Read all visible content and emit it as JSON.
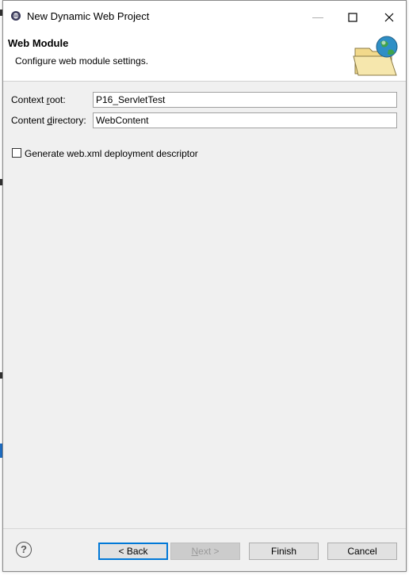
{
  "window": {
    "title": "New Dynamic Web Project",
    "minimize_glyph": "—",
    "maximize_glyph": "☐",
    "close_glyph": "✕"
  },
  "header": {
    "title": "Web Module",
    "description": "Configure web module settings.",
    "image_icon": "folder-globe-icon"
  },
  "form": {
    "context_root": {
      "label_pre": "Context ",
      "label_mnemonic": "r",
      "label_post": "oot:",
      "value": "P16_ServletTest"
    },
    "content_directory": {
      "label_pre": "Content ",
      "label_mnemonic": "d",
      "label_post": "irectory:",
      "value": "WebContent"
    },
    "generate_descriptor": {
      "label": "Generate web.xml deployment descriptor",
      "checked": false
    }
  },
  "footer": {
    "help_glyph": "?",
    "back_label": "< Back",
    "next_label_mnemonic": "N",
    "next_label_rest": "ext >",
    "finish_label": "Finish",
    "cancel_label": "Cancel"
  },
  "colors": {
    "accent": "#0078d7",
    "dialog_bg": "#f0f0f0",
    "header_bg": "#ffffff"
  }
}
